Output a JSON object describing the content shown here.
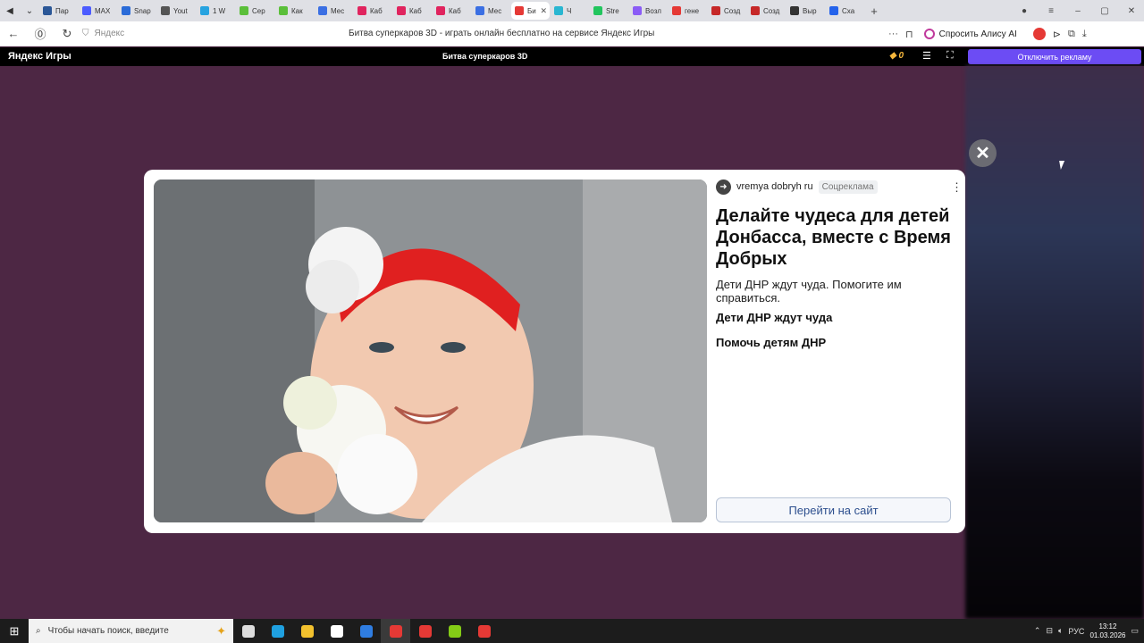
{
  "browser": {
    "tabs": [
      {
        "label": "Пар",
        "color": "#2b5797",
        "active": false
      },
      {
        "label": "MAX",
        "color": "#4c5cff",
        "active": false
      },
      {
        "label": "Snap",
        "color": "#2a6bd8",
        "active": false
      },
      {
        "label": "Yout",
        "color": "#555555",
        "active": false
      },
      {
        "label": "1 W",
        "color": "#27a3e0",
        "active": false
      },
      {
        "label": "Сер",
        "color": "#5bbf3a",
        "active": false
      },
      {
        "label": "Как",
        "color": "#5bbf3a",
        "active": false
      },
      {
        "label": "Мес",
        "color": "#3b6fe3",
        "active": false
      },
      {
        "label": "Каб",
        "color": "#e0245e",
        "active": false
      },
      {
        "label": "Каб",
        "color": "#e0245e",
        "active": false
      },
      {
        "label": "Каб",
        "color": "#e0245e",
        "active": false
      },
      {
        "label": "Мес",
        "color": "#3b6fe3",
        "active": false
      },
      {
        "label": "Би",
        "color": "#e53935",
        "active": true
      },
      {
        "label": "Ч",
        "color": "#29b6d1",
        "active": false
      },
      {
        "label": "Stre",
        "color": "#22c55e",
        "active": false
      },
      {
        "label": "Возл",
        "color": "#8b5cf6",
        "active": false
      },
      {
        "label": "гене",
        "color": "#e53935",
        "active": false
      },
      {
        "label": "Созд",
        "color": "#c62828",
        "active": false
      },
      {
        "label": "Созд",
        "color": "#c62828",
        "active": false
      },
      {
        "label": "Выр",
        "color": "#333333",
        "active": false
      },
      {
        "label": "Сха",
        "color": "#2563eb",
        "active": false
      }
    ],
    "site_label": "Яндекс",
    "page_title": "Битва суперкаров 3D - играть онлайн бесплатно на сервисе Яндекс Игры",
    "alice_label": "Спросить Алису AI"
  },
  "yandex_games": {
    "logo": "Яндекс Игры",
    "game_title": "Битва суперкаров 3D",
    "coins": "0",
    "disable_ads_label": "Отключить рекламу"
  },
  "ad": {
    "source_name": "vremya dobryh ru",
    "badge": "Соцреклама",
    "title": "Делайте чудеса для детей Донбасса, вместе с Время Добрых",
    "text": "Дети ДНР ждут чуда. Помогите им справиться.",
    "link1": "Дети ДНР ждут чуда",
    "link2": "Помочь детям ДНР",
    "cta_label": "Перейти на сайт"
  },
  "taskbar": {
    "search_placeholder": "Чтобы начать поиск, введите",
    "apps": [
      {
        "name": "task-view",
        "color": "#dddddd"
      },
      {
        "name": "edge",
        "color": "#1fa0e0"
      },
      {
        "name": "explorer",
        "color": "#f2c12e"
      },
      {
        "name": "store",
        "color": "#ffffff"
      },
      {
        "name": "mail",
        "color": "#2f7de1"
      },
      {
        "name": "yandex-browser",
        "color": "#e53935"
      },
      {
        "name": "yandex",
        "color": "#e53935"
      },
      {
        "name": "app-green",
        "color": "#84cc16"
      },
      {
        "name": "app-chrome",
        "color": "#e53935"
      }
    ],
    "language": "РУС",
    "time": "13:12",
    "date": "01.03.2026"
  }
}
